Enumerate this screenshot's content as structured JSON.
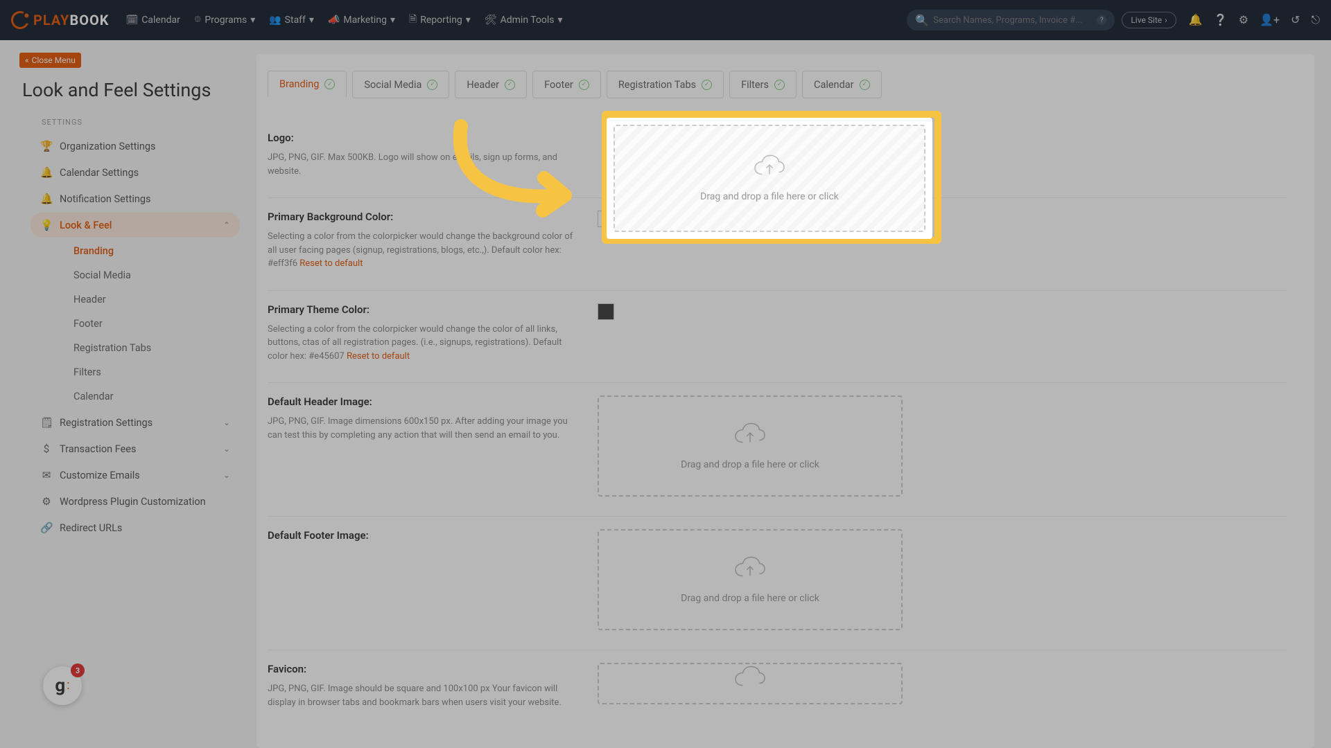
{
  "brand": {
    "play": "PLAY",
    "book": "BOOK"
  },
  "nav": {
    "calendar": "Calendar",
    "programs": "Programs",
    "staff": "Staff",
    "marketing": "Marketing",
    "reporting": "Reporting",
    "admin": "Admin Tools"
  },
  "search": {
    "placeholder": "Search Names, Programs, Invoice #..."
  },
  "live_site": "Live Site",
  "close_menu": "Close Menu",
  "page_title": "Look and Feel Settings",
  "section_label": "SETTINGS",
  "sidebar": {
    "org": "Organization Settings",
    "cal": "Calendar Settings",
    "notif": "Notification Settings",
    "look": "Look & Feel",
    "sub": {
      "branding": "Branding",
      "social": "Social Media",
      "header": "Header",
      "footer": "Footer",
      "regtabs": "Registration Tabs",
      "filters": "Filters",
      "calendar": "Calendar"
    },
    "reg": "Registration Settings",
    "fees": "Transaction Fees",
    "emails": "Customize Emails",
    "wp": "Wordpress Plugin Customization",
    "redirect": "Redirect URLs"
  },
  "tabs": {
    "branding": "Branding",
    "social": "Social Media",
    "header": "Header",
    "footer": "Footer",
    "regtabs": "Registration Tabs",
    "filters": "Filters",
    "calendar": "Calendar"
  },
  "sections": {
    "logo": {
      "title": "Logo:",
      "desc": "JPG, PNG, GIF. Max 500KB. Logo will show on emails, sign up forms, and website."
    },
    "bgcolor": {
      "title": "Primary Background Color:",
      "desc_a": "Selecting a color from the colorpicker would change the background color of all user facing pages (signup, registrations, blogs, etc.,). Default color hex: #eff3f6 ",
      "reset": "Reset to default",
      "swatch": "#ffffff"
    },
    "theme": {
      "title": "Primary Theme Color:",
      "desc_a": "Selecting a color from the colorpicker would change the color of all links, buttons, ctas of all registration pages. (i.e., signups, registrations). Default color hex: #e45607 ",
      "reset": "Reset to default",
      "swatch": "#3f3f3f"
    },
    "headerimg": {
      "title": "Default Header Image:",
      "desc": "JPG, PNG, GIF. Image dimensions 600x150 px. After adding your image you can test this by completing any action that will then send an email to you."
    },
    "footerimg": {
      "title": "Default Footer Image:"
    },
    "favicon": {
      "title": "Favicon:",
      "desc": "JPG, PNG, GIF. Image should be square and 100x100 px Your favicon will display in browser tabs and bookmark bars when users visit your website."
    }
  },
  "dropzone_text": "Drag and drop a file here or click",
  "g_badge": "3"
}
